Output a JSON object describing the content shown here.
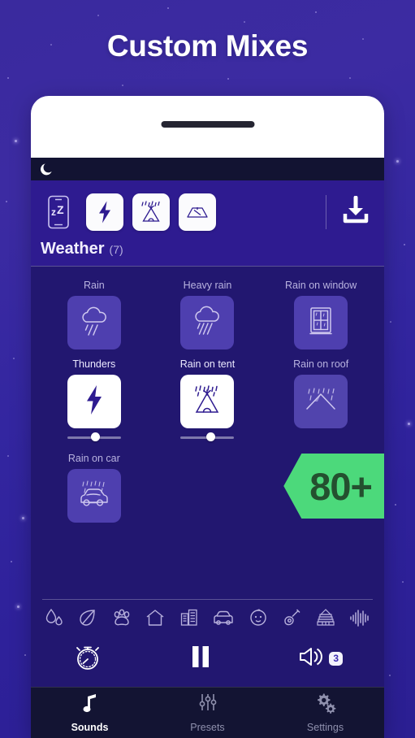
{
  "promo": {
    "title": "Custom Mixes",
    "badge": "80+"
  },
  "app": {
    "statusbar": {
      "icon": "moon-sleep-icon"
    },
    "header": {
      "quick_actions": [
        {
          "name": "phone-sleep-icon",
          "style": "outline"
        },
        {
          "name": "thunder-icon",
          "style": "filled"
        },
        {
          "name": "rain-on-tent-icon",
          "style": "filled"
        },
        {
          "name": "rain-on-roof-icon",
          "style": "filled"
        }
      ],
      "download_icon": "download-icon"
    },
    "section": {
      "title": "Weather",
      "count": "(7)"
    },
    "sounds": [
      {
        "label": "Rain",
        "icon": "rain-cloud-icon",
        "active": false,
        "volume": null
      },
      {
        "label": "Heavy rain",
        "icon": "heavy-rain-cloud-icon",
        "active": false,
        "volume": null
      },
      {
        "label": "Rain on window",
        "icon": "rain-on-window-icon",
        "active": false,
        "volume": null
      },
      {
        "label": "Thunders",
        "icon": "thunder-icon",
        "active": true,
        "volume": 45
      },
      {
        "label": "Rain on tent",
        "icon": "rain-on-tent-icon",
        "active": true,
        "volume": 48
      },
      {
        "label": "Rain on roof",
        "icon": "rain-on-roof-icon",
        "active": false,
        "volume": null
      },
      {
        "label": "Rain on car",
        "icon": "rain-on-car-icon",
        "active": false,
        "volume": null
      }
    ],
    "categories": [
      "water-drops-icon",
      "leaf-icon",
      "paw-icon",
      "home-icon",
      "city-icon",
      "car-icon",
      "baby-icon",
      "guitar-icon",
      "temple-icon",
      "waveform-icon"
    ],
    "transport": {
      "timer_icon": "stopwatch-icon",
      "play_pause_icon": "pause-icon",
      "volume_icon": "speaker-icon",
      "volume_count": "3"
    },
    "bottom_nav": [
      {
        "label": "Sounds",
        "icon": "music-note-icon",
        "active": true
      },
      {
        "label": "Presets",
        "icon": "sliders-icon",
        "active": false
      },
      {
        "label": "Settings",
        "icon": "gears-icon",
        "active": false
      }
    ]
  },
  "colors": {
    "page_bg": "#3326a0",
    "app_bg": "#221770",
    "header_bg": "#2e1b90",
    "tile_inactive": "#4e3faf",
    "tile_active": "#ffffff",
    "accent_green": "#4cd97b",
    "nav_bg": "#131433",
    "icon_purple": "#2e1b90"
  }
}
